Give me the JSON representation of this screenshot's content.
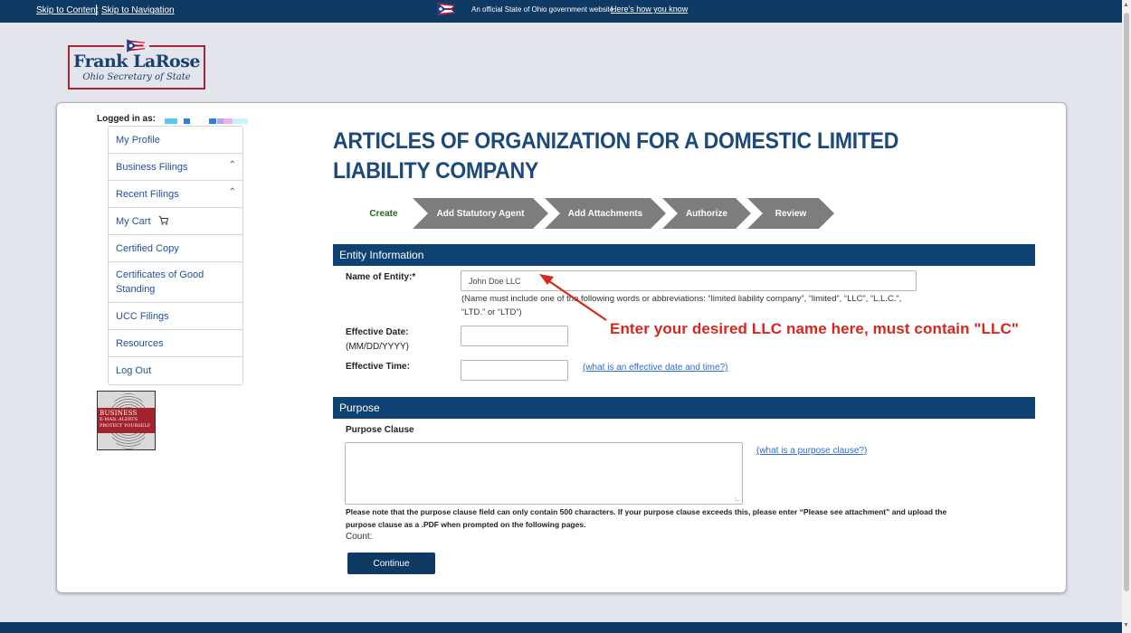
{
  "topbar": {
    "skip_content": "Skip to Content",
    "skip_nav": "Skip to Navigation",
    "official": "An official State of Ohio government website.",
    "how_know": "Here's how you know"
  },
  "logo": {
    "name": "Frank LaRose",
    "subtitle": "Ohio Secretary of State"
  },
  "sidebar": {
    "logged_in": "Logged in as:",
    "items": [
      {
        "label": "My Profile"
      },
      {
        "label": "Business Filings",
        "icon": "chevron-updown-icon"
      },
      {
        "label": "Recent Filings",
        "icon": "chevron-updown-icon"
      },
      {
        "label": "My Cart",
        "icon": "cart-icon"
      },
      {
        "label": "Certified Copy"
      },
      {
        "label": "Certificates of Good Standing"
      },
      {
        "label": "UCC Filings"
      },
      {
        "label": "Resources"
      },
      {
        "label": "Log Out"
      }
    ],
    "alerts_banner": {
      "line1": "BUSINESS",
      "line2": "E-MAIL ALERTS",
      "line3": "PROTECT YOURSELF"
    }
  },
  "main": {
    "title": "ARTICLES OF ORGANIZATION FOR A DOMESTIC LIMITED LIABILITY COMPANY",
    "steps": [
      "Create",
      "Add Statutory Agent",
      "Add Attachments",
      "Authorize",
      "Review"
    ],
    "entity_section": {
      "header": "Entity Information",
      "name_label": "Name of Entity:*",
      "name_value": "John Doe LLC",
      "name_note": "(Name must include one of the following words or abbreviations: “limited liability company”, “limited”, “LLC”, “L.L.C.”, “LTD.” or “LTD”)",
      "date_label": "Effective Date:",
      "date_format": "(MM/DD/YYYY)",
      "time_label": "Effective Time:",
      "time_link": "(what is an effective date and time?)"
    },
    "annotation": "Enter your desired LLC name here, must contain \"LLC\"",
    "purpose_section": {
      "header": "Purpose",
      "clause_label": "Purpose Clause",
      "clause_link": "(what is a purpose clause?)",
      "note": "Please note that the purpose clause field can only contain 500 characters. If your purpose clause exceeds this, please enter “Please see attachment” and upload the purpose clause as a .PDF when prompted on the following pages.",
      "count_label": "Count:"
    },
    "continue_button": "Continue"
  },
  "colors": {
    "navy": "#0e3a64",
    "title_blue": "#1b4a7a",
    "annotation_red": "#d8261b",
    "step_gray": "#7d7d7d",
    "create_green": "#1e6a1e"
  }
}
